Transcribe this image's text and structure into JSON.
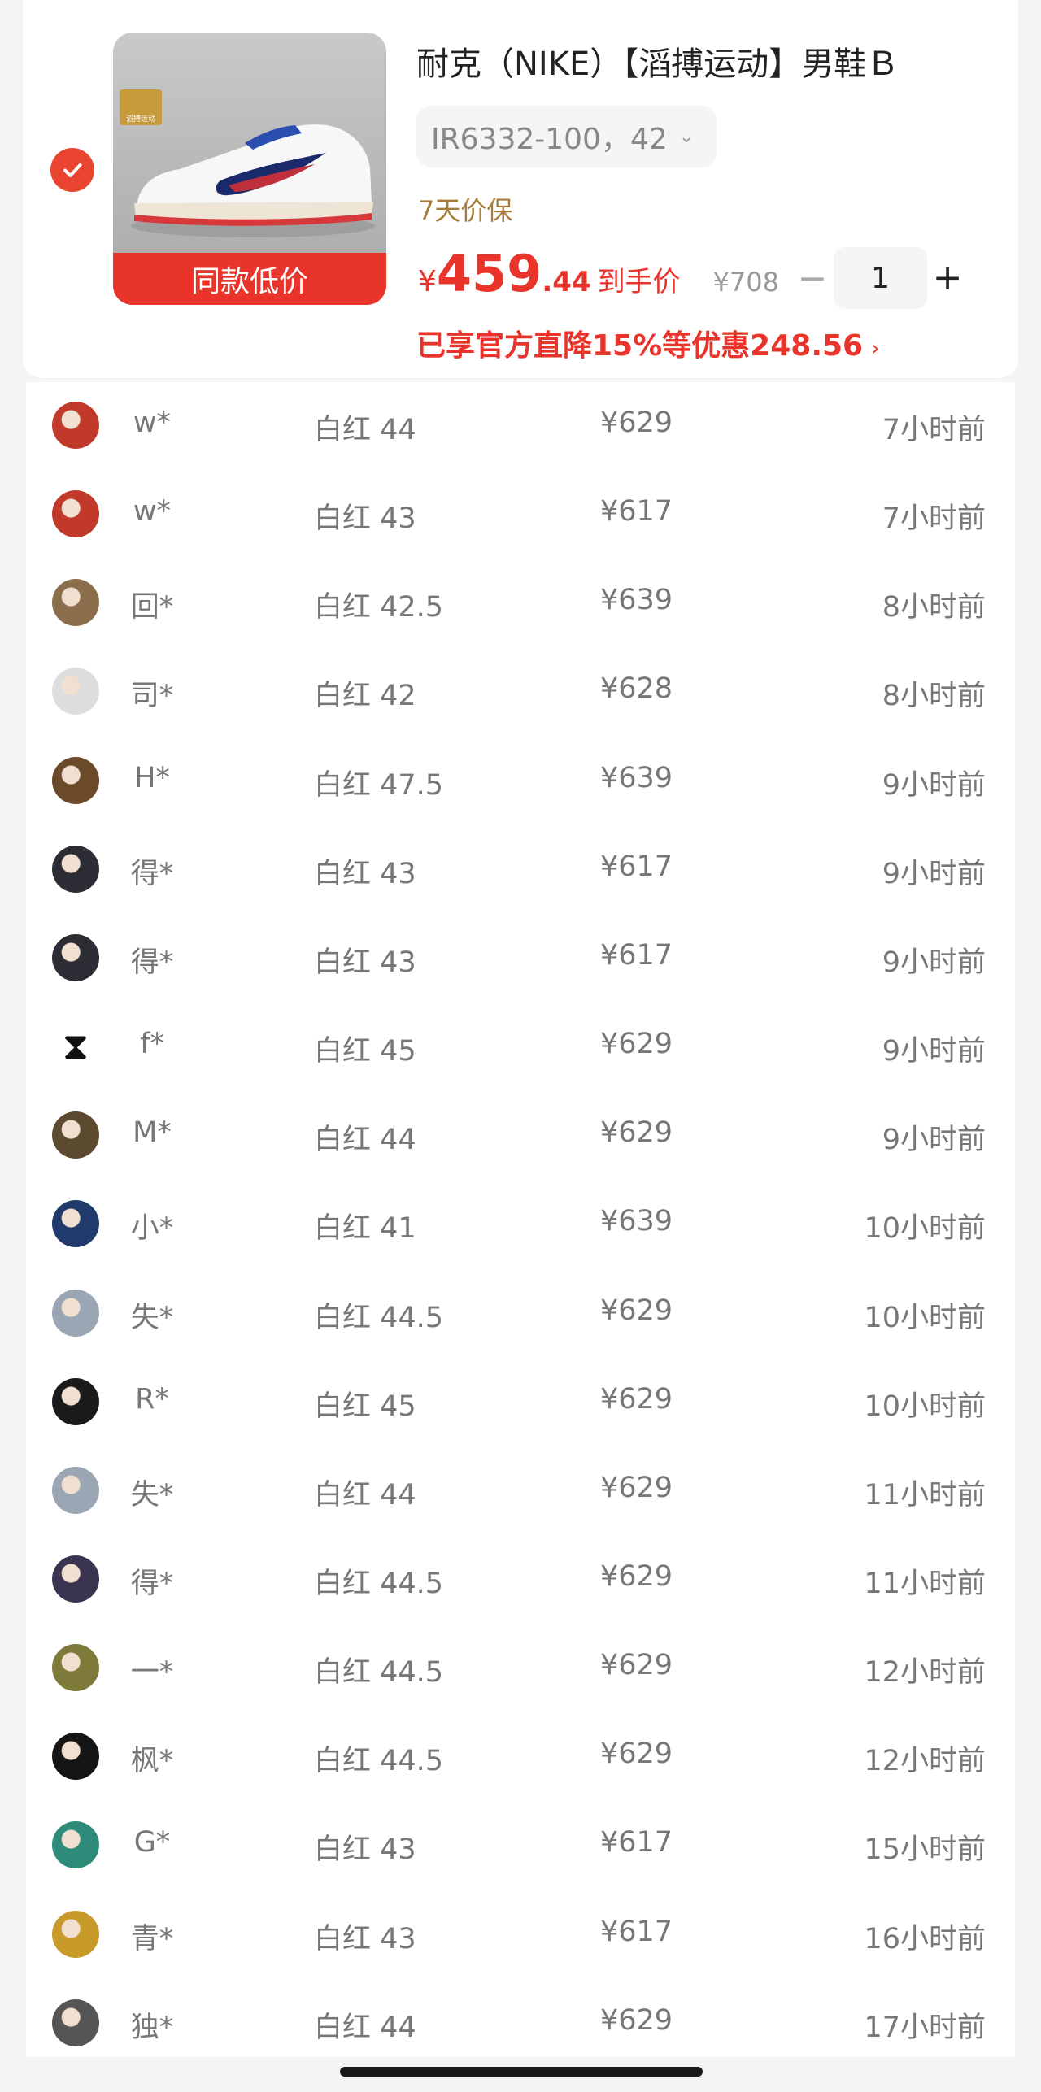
{
  "product": {
    "title": "耐克（NIKE）【滔搏运动】男鞋Ｂ",
    "variant": "IR6332-100，42",
    "price_guard": "7天价保",
    "price_currency": "¥",
    "price_int": "459",
    "price_dec": ".44",
    "price_label": "到手价",
    "original_price": "¥708",
    "quantity": "1",
    "discount_text": "已享官方直降15%等优惠248.56",
    "thumb_badge": "同款低价",
    "shop_badge": "滔搏运动",
    "accent_color": "#e8342a",
    "guard_color": "#a67c3a",
    "icons": {
      "check": "check-circle-icon",
      "chevron": "chevron-down-icon",
      "arrow": "chevron-right-icon",
      "minus": "minus-icon",
      "plus": "plus-icon"
    }
  },
  "purchases": [
    {
      "name": "w*",
      "spec": "白红 44",
      "price": "¥629",
      "time": "7小时前",
      "avatar_color": "#c0392b"
    },
    {
      "name": "w*",
      "spec": "白红 43",
      "price": "¥617",
      "time": "7小时前",
      "avatar_color": "#c0392b"
    },
    {
      "name": "回*",
      "spec": "白红 42.5",
      "price": "¥639",
      "time": "8小时前",
      "avatar_color": "#8a6d4a"
    },
    {
      "name": "司*",
      "spec": "白红 42",
      "price": "¥628",
      "time": "8小时前",
      "avatar_color": "#dddddd"
    },
    {
      "name": "H*",
      "spec": "白红 47.5",
      "price": "¥639",
      "time": "9小时前",
      "avatar_color": "#6b4a2a"
    },
    {
      "name": "得*",
      "spec": "白红 43",
      "price": "¥617",
      "time": "9小时前",
      "avatar_color": "#2c2c34"
    },
    {
      "name": "得*",
      "spec": "白红 43",
      "price": "¥617",
      "time": "9小时前",
      "avatar_color": "#2c2c34"
    },
    {
      "name": "f*",
      "spec": "白红 45",
      "price": "¥629",
      "time": "9小时前",
      "avatar_color": "#111111"
    },
    {
      "name": "M*",
      "spec": "白红 44",
      "price": "¥629",
      "time": "9小时前",
      "avatar_color": "#5b4a2e"
    },
    {
      "name": "小*",
      "spec": "白红 41",
      "price": "¥639",
      "time": "10小时前",
      "avatar_color": "#1f3a6b"
    },
    {
      "name": "失*",
      "spec": "白红 44.5",
      "price": "¥629",
      "time": "10小时前",
      "avatar_color": "#9aa6b4"
    },
    {
      "name": "R*",
      "spec": "白红 45",
      "price": "¥629",
      "time": "10小时前",
      "avatar_color": "#1a1a1a"
    },
    {
      "name": "失*",
      "spec": "白红 44",
      "price": "¥629",
      "time": "11小时前",
      "avatar_color": "#9aa6b4"
    },
    {
      "name": "得*",
      "spec": "白红 44.5",
      "price": "¥629",
      "time": "11小时前",
      "avatar_color": "#3a3450"
    },
    {
      "name": "一*",
      "spec": "白红 44.5",
      "price": "¥629",
      "time": "12小时前",
      "avatar_color": "#7d7a3a"
    },
    {
      "name": "枫*",
      "spec": "白红 44.5",
      "price": "¥629",
      "time": "12小时前",
      "avatar_color": "#151515"
    },
    {
      "name": "G*",
      "spec": "白红 43",
      "price": "¥617",
      "time": "15小时前",
      "avatar_color": "#2e8b7a"
    },
    {
      "name": "青*",
      "spec": "白红 43",
      "price": "¥617",
      "time": "16小时前",
      "avatar_color": "#c89a2a"
    },
    {
      "name": "独*",
      "spec": "白红 44",
      "price": "¥629",
      "time": "17小时前",
      "avatar_color": "#555555"
    }
  ]
}
